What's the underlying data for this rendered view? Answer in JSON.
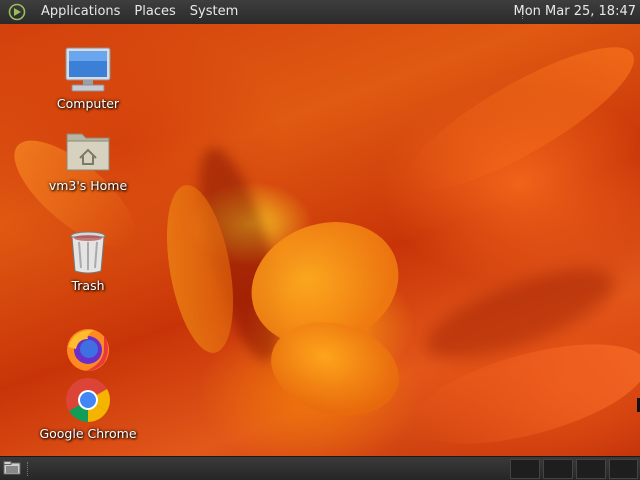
{
  "top_panel": {
    "menus": [
      "Applications",
      "Places",
      "System"
    ],
    "clock": "Mon Mar 25, 18:47"
  },
  "desktop": {
    "icons": [
      {
        "label": "Computer",
        "icon": "computer-icon"
      },
      {
        "label": "vm3's Home",
        "icon": "home-folder-icon"
      },
      {
        "label": "Trash",
        "icon": "trash-icon"
      },
      {
        "label": "",
        "icon": "firefox-icon"
      },
      {
        "label": "Google Chrome",
        "icon": "chrome-icon"
      }
    ]
  },
  "bottom_panel": {
    "show_desktop_icon": "show-desktop-icon",
    "workspaces": 4
  },
  "colors": {
    "panel": "#2e2e2e",
    "wallpaper_primary": "#d2400c",
    "wallpaper_highlight": "#ffb020"
  }
}
